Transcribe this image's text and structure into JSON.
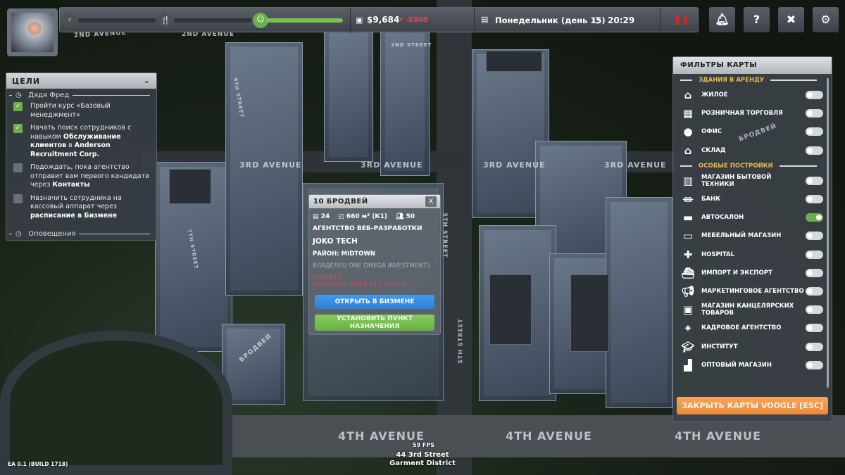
{
  "hud": {
    "money": "$9,684",
    "money_change": "-$305",
    "day": "Понедельник (день 15)",
    "time": "20:29",
    "energy_level": 0.05,
    "hunger_level": 0.0,
    "happiness_level": 1.0
  },
  "goals": {
    "title": "ЦЕЛИ",
    "section": "Дядя Фред",
    "items": [
      {
        "pre": "Пройти курс «Базовый менеджмент»",
        "bold": "",
        "post": "",
        "done": true
      },
      {
        "pre": "Начать поиск сотрудников с навыком ",
        "bold": "Обслуживание клиентов",
        "post": " в ",
        "bold2": "Anderson Recruitment Corp.",
        "done": true
      },
      {
        "pre": "Подождать, пока агентство отправит вам первого кандидата через ",
        "bold": "Контакты",
        "post": "",
        "done": false
      },
      {
        "pre": "Назначить сотрудника на кассовый аппарат через ",
        "bold": "расписание в Бизмене",
        "post": "",
        "done": false
      }
    ],
    "notifications": "Оповещения"
  },
  "popup": {
    "title": "10 БРОДВЕЙ",
    "close": "X",
    "floors": "24",
    "area": "660 м² (К1)",
    "capacity": "50",
    "type": "АГЕНТСТВО ВЕБ-РАЗРАБОТКИ",
    "name": "JOKO TECH",
    "district": "РАЙОН: MIDTOWN",
    "owner": "ВЛАДЕЛЕЦ ONE OMEGA INVESTMENTS",
    "status": "ЗАКРЫТО",
    "opening": "ОТКРЫТИЕ ЧЕРЕЗ 14 Ч (10:00)",
    "open_btn": "ОТКРЫТЬ В БИЗМЕНЕ",
    "dest_btn": "УСТАНОВИТЬ ПУНКТ НАЗНАЧЕНИЯ"
  },
  "filters": {
    "title": "ФИЛЬТРЫ КАРТЫ",
    "rent_section": "ЗДАНИЯ В АРЕНДУ",
    "special_section": "ОСОБЫЕ ПОСТРОЙКИ",
    "rent": [
      {
        "label": "ЖИЛОЕ",
        "icon": "house-icon",
        "on": false
      },
      {
        "label": "РОЗНИЧНАЯ ТОРГОВЛЯ",
        "icon": "shop-icon",
        "on": false
      },
      {
        "label": "ОФИС",
        "icon": "office-worker-icon",
        "on": false
      },
      {
        "label": "СКЛАД",
        "icon": "warehouse-icon",
        "on": false
      }
    ],
    "special": [
      {
        "label": "МАГАЗИН БЫТОВОЙ ТЕХНИКИ",
        "icon": "appliance-icon",
        "on": false
      },
      {
        "label": "БАНК",
        "icon": "bank-icon",
        "on": false
      },
      {
        "label": "АВТОСАЛОН",
        "icon": "car-icon",
        "on": true
      },
      {
        "label": "МЕБЕЛЬНЫЙ МАГАЗИН",
        "icon": "sofa-icon",
        "on": false
      },
      {
        "label": "HOSPITAL",
        "icon": "hospital-icon",
        "on": false
      },
      {
        "label": "ИМПОРТ И ЭКСПОРТ",
        "icon": "ship-icon",
        "on": false
      },
      {
        "label": "МАРКЕТИНГОВОЕ АГЕНТСТВО",
        "icon": "megaphone-icon",
        "on": false
      },
      {
        "label": "МАГАЗИН КАНЦЕЛЯРСКИХ ТОВАРОВ",
        "icon": "desk-icon",
        "on": false
      },
      {
        "label": "КАДРОВОЕ АГЕНТСТВО",
        "icon": "recruit-icon",
        "on": false
      },
      {
        "label": "ИНСТИТУТ",
        "icon": "graduation-cap-icon",
        "on": false
      },
      {
        "label": "ОПТОВЫЙ МАГАЗИН",
        "icon": "forklift-icon",
        "on": false
      }
    ],
    "close_btn": "ЗАКРЫТЬ КАРТЫ VOOGLE [ESC]"
  },
  "map": {
    "streets": [
      "2ND AVENUE",
      "2ND AVENUE",
      "3RD AVENUE",
      "3RD AVENUE",
      "3RD AVENUE",
      "3RD AVENUE",
      "4TH AVENUE",
      "4TH AVENUE",
      "4TH AVENUE",
      "5TH STREET",
      "5TH STREET",
      "БРОДВЕЙ",
      "БРОДВЕЙ",
      "7TH STREET",
      "9TH STREET",
      "2ND STREET"
    ]
  },
  "footer": {
    "fps": "59 FPS",
    "address": "44 3rd Street",
    "district": "Garment District",
    "build": "EA 0.1 (BUILD 1718)"
  },
  "colors": {
    "accent_green": "#6ab04c",
    "accent_blue": "#3a8ee6",
    "accent_orange": "#f09a48",
    "warning_red": "#e0445a"
  }
}
